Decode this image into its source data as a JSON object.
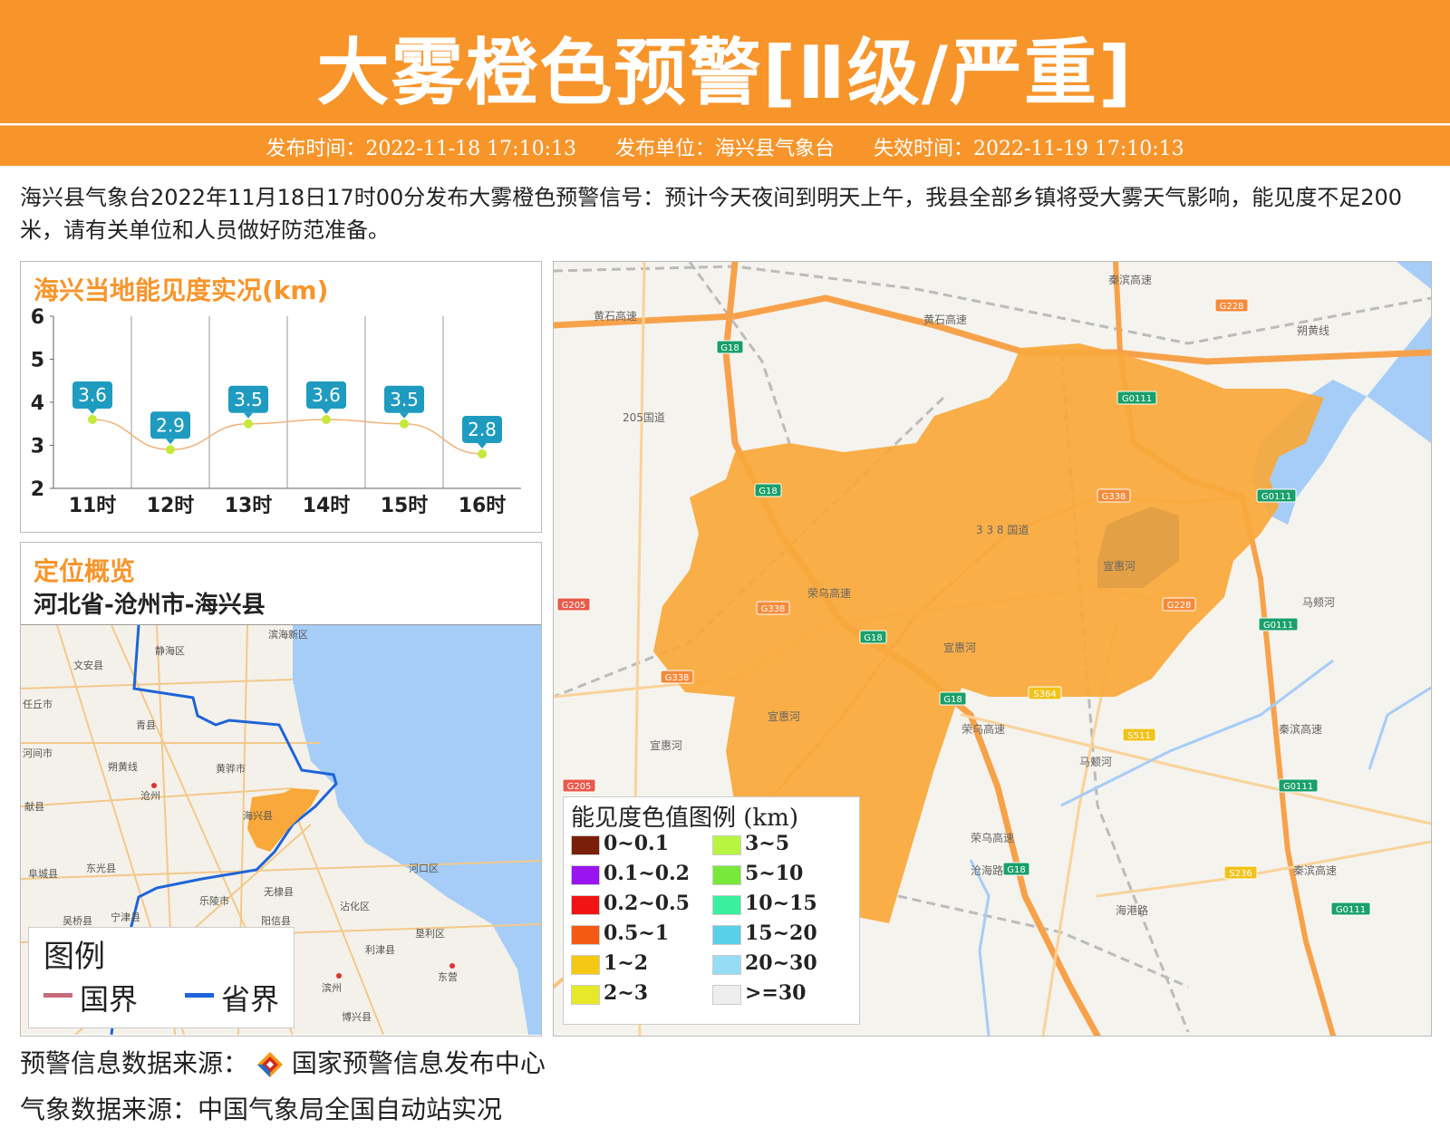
{
  "header": {
    "title": "大雾橙色预警[Ⅱ级/严重]",
    "publish_time": "发布时间：2022-11-18 17:10:13",
    "publisher": "发布单位：海兴县气象台",
    "expire_time": "失效时间：2022-11-19 17:10:13"
  },
  "description": "海兴县气象台2022年11月18日17时00分发布大雾橙色预警信号：预计今天夜间到明天上午，我县全部乡镇将受大雾天气影响，能见度不足200米，请有关单位和人员做好防范准备。",
  "chart_panel": {
    "title": "海兴当地能见度实况(km)"
  },
  "chart_data": {
    "type": "line",
    "title": "海兴当地能见度实况(km)",
    "categories": [
      "11时",
      "12时",
      "13时",
      "14时",
      "15时",
      "16时"
    ],
    "values": [
      3.6,
      2.9,
      3.5,
      3.6,
      3.5,
      2.8
    ],
    "yticks": [
      "2",
      "3",
      "4",
      "5",
      "6"
    ],
    "ylim": [
      2,
      6
    ],
    "grid": true
  },
  "location_panel": {
    "title": "定位概览",
    "path": "河北省-沧州市-海兴县",
    "places": [
      "滨海新区",
      "静海区",
      "文安县",
      "青县",
      "任丘市",
      "河间市",
      "朔黄线",
      "黄骅市",
      "沧州",
      "献县",
      "海兴县",
      "阜城县",
      "东光县",
      "乐陵市",
      "无棣县",
      "河口区",
      "宁津县",
      "阳信县",
      "沾化区",
      "吴桥县",
      "利津县",
      "垦利区",
      "滨州",
      "东营",
      "博兴县"
    ],
    "legend": {
      "title": "图例",
      "national": "国界",
      "provincial": "省界"
    }
  },
  "main_map": {
    "road_labels": [
      "黄石高速",
      "黄石高速",
      "秦滨高速",
      "205国道",
      "G18",
      "G18",
      "G18",
      "G18",
      "G18",
      "G228",
      "G228",
      "G0111",
      "G0111",
      "G0111",
      "G0111",
      "G0111",
      "G338",
      "G338",
      "G338",
      "3 3 8 国道",
      "宣惠河",
      "宣惠河",
      "宣惠河",
      "宣惠河",
      "G205",
      "G205",
      "S364",
      "S511",
      "S236",
      "马颊河",
      "马颊河",
      "荣乌高速",
      "荣乌高速",
      "荣乌高速",
      "朔黄线",
      "沧海路",
      "海港路",
      "秦滨高速",
      "秦滨高速"
    ],
    "legend_title": "能见度色值图例 (km)",
    "legend_items": [
      {
        "label": "0~0.1",
        "color": "#7a1f0a"
      },
      {
        "label": "3~5",
        "color": "#b8f542"
      },
      {
        "label": "0.1~0.2",
        "color": "#9a14f0"
      },
      {
        "label": "5~10",
        "color": "#78e83a"
      },
      {
        "label": "0.2~0.5",
        "color": "#f01414"
      },
      {
        "label": "10~15",
        "color": "#3af0a0"
      },
      {
        "label": "0.5~1",
        "color": "#f55a14"
      },
      {
        "label": "15~20",
        "color": "#5ad0e8"
      },
      {
        "label": "1~2",
        "color": "#f5c814"
      },
      {
        "label": "20~30",
        "color": "#96dcf5"
      },
      {
        "label": "2~3",
        "color": "#e8e82a"
      },
      {
        "label": ">=30",
        "color": "#eeeeee"
      }
    ]
  },
  "footer": {
    "warning_source": "预警信息数据来源：",
    "warning_org": "国家预警信息发布中心",
    "weather_source": "气象数据来源：中国气象局全国自动站实况"
  },
  "colors": {
    "accent": "#f7952b",
    "fog_area": "#f9a83a",
    "chart_label": "#1f9bc0",
    "chart_point": "#c6e83a"
  }
}
